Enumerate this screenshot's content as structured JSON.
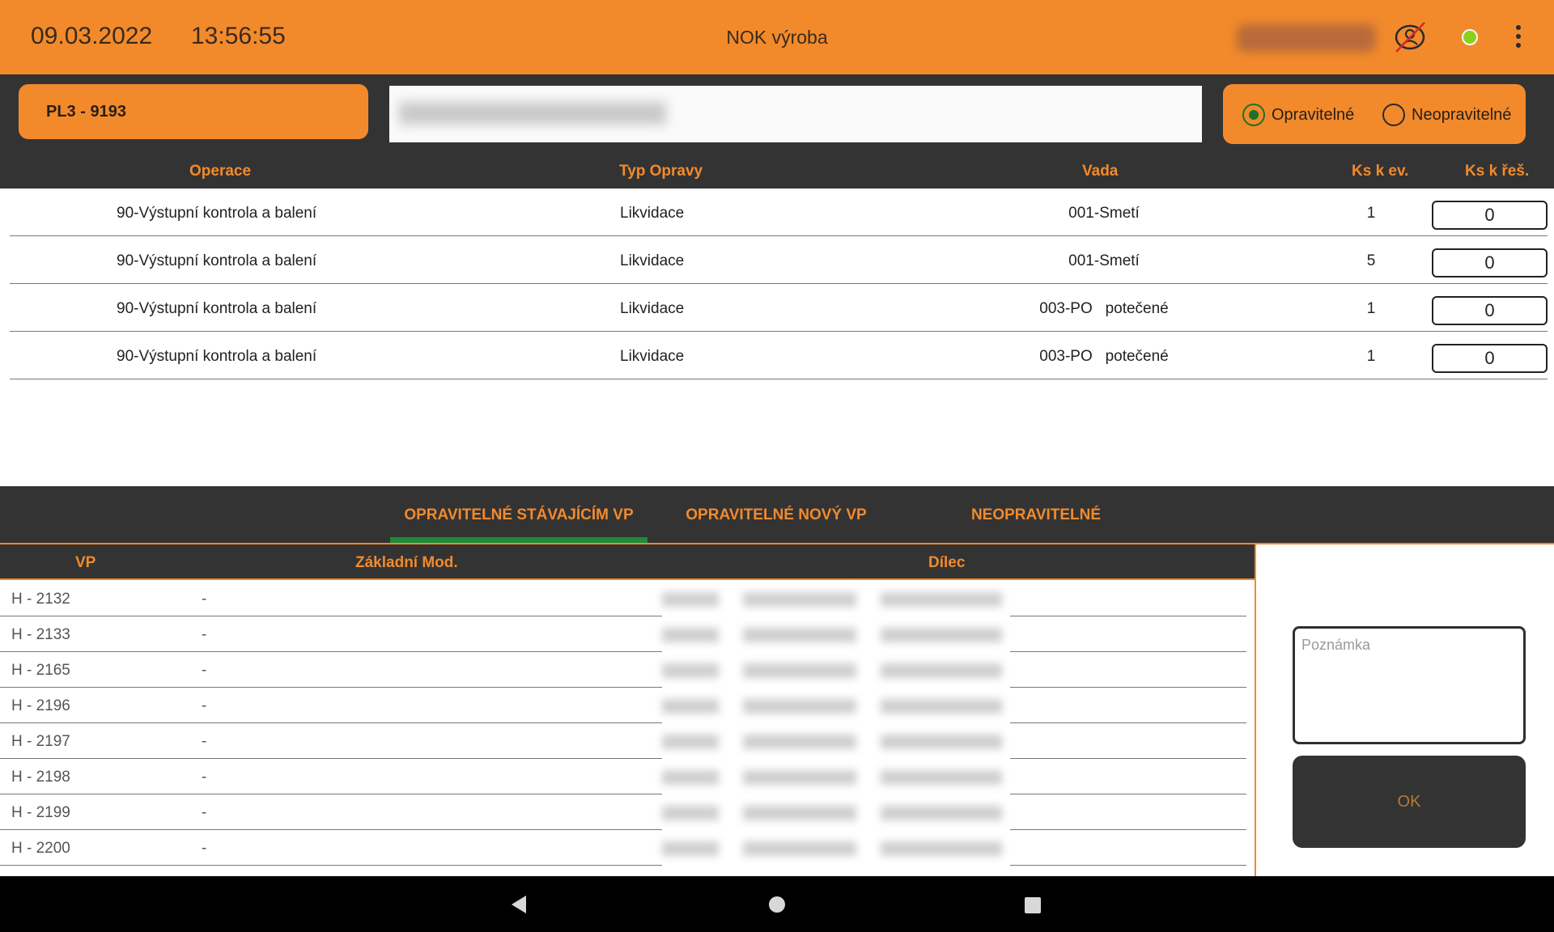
{
  "header": {
    "date": "09.03.2022",
    "time": "13:56:55",
    "title": "NOK výroba",
    "accent_color": "#f28a2c",
    "status_color": "#8ad11e",
    "icons": [
      "user-off-icon",
      "status-dot-icon",
      "more-vert-icon"
    ]
  },
  "toolbar": {
    "workplace_label": "PL3 - 9193",
    "radio_options": [
      {
        "label": "Opravitelné",
        "selected": true
      },
      {
        "label": "Neopravitelné",
        "selected": false
      }
    ]
  },
  "top_table": {
    "columns": [
      "Operace",
      "Typ Opravy",
      "Vada",
      "Ks k ev.",
      "Ks k řeš."
    ],
    "rows": [
      {
        "operace": "90-Výstupní kontrola a balení",
        "typ": "Likvidace",
        "vada": "001-Smetí",
        "ks_ev": "1",
        "ks_res": "0"
      },
      {
        "operace": "90-Výstupní kontrola a balení",
        "typ": "Likvidace",
        "vada": "001-Smetí",
        "ks_ev": "5",
        "ks_res": "0"
      },
      {
        "operace": "90-Výstupní kontrola a balení",
        "typ": "Likvidace",
        "vada": "003-PO   potečené",
        "ks_ev": "1",
        "ks_res": "0"
      },
      {
        "operace": "90-Výstupní kontrola a balení",
        "typ": "Likvidace",
        "vada": "003-PO   potečené",
        "ks_ev": "1",
        "ks_res": "0"
      }
    ]
  },
  "tabs": [
    {
      "label": "OPRAVITELNÉ STÁVAJÍCÍM VP",
      "active": true,
      "active_color": "#1f8a3a"
    },
    {
      "label": "OPRAVITELNÉ NOVÝ VP",
      "active": false
    },
    {
      "label": "NEOPRAVITELNÉ",
      "active": false
    }
  ],
  "bottom_table": {
    "columns": [
      "VP",
      "Základní Mod.",
      "Dílec"
    ],
    "rows": [
      {
        "vp": "H - 2132",
        "mod": "-"
      },
      {
        "vp": "H - 2133",
        "mod": "-"
      },
      {
        "vp": "H - 2165",
        "mod": "-"
      },
      {
        "vp": "H - 2196",
        "mod": "-"
      },
      {
        "vp": "H - 2197",
        "mod": "-"
      },
      {
        "vp": "H - 2198",
        "mod": "-"
      },
      {
        "vp": "H - 2199",
        "mod": "-"
      },
      {
        "vp": "H - 2200",
        "mod": "-"
      }
    ]
  },
  "side_panel": {
    "note_placeholder": "Poznámka",
    "ok_label": "OK"
  },
  "navbar": {
    "icons": [
      "back-icon",
      "home-icon",
      "recents-icon"
    ]
  }
}
